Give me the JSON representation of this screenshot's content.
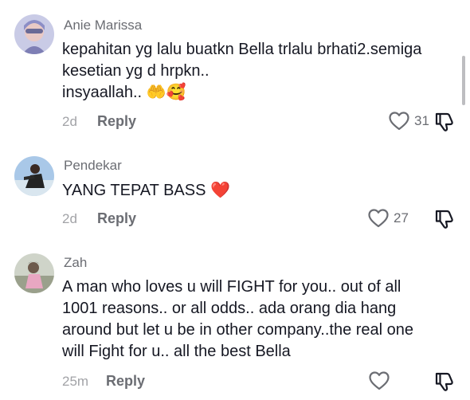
{
  "comments": [
    {
      "username": "Anie Marissa",
      "lines": [
        "kepahitan yg lalu buatkn Bella trlalu brhati2.semiga",
        "kesetian yg d hrpkn..",
        "insyaallah.. 🤲🥰"
      ],
      "time": "2d",
      "reply_label": "Reply",
      "likes": "31"
    },
    {
      "username": "Pendekar",
      "lines": [
        "YANG TEPAT BASS ❤️"
      ],
      "time": "2d",
      "reply_label": "Reply",
      "likes": "27"
    },
    {
      "username": "Zah",
      "lines": [
        "A man who loves u will FIGHT for you.. out of all",
        "1001 reasons.. or all odds.. ada orang dia hang",
        "around but let u be in other company..the real one",
        "will Fight for u.. all the best Bella"
      ],
      "time": "25m",
      "reply_label": "Reply",
      "likes": ""
    }
  ],
  "colors": {
    "text": "#161823",
    "secondary": "#6b6d73",
    "muted": "#a2a3a7"
  },
  "icons": [
    "heart-outline-icon",
    "dislike-icon"
  ]
}
